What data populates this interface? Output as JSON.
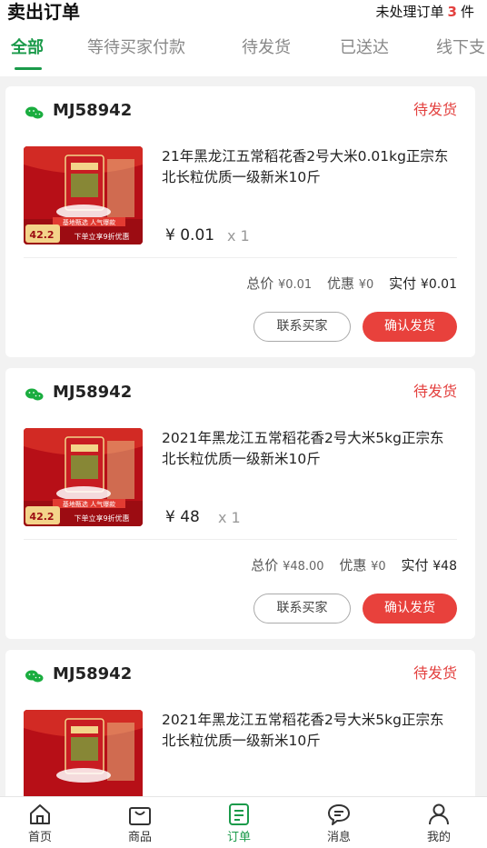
{
  "header": {
    "title": "卖出订单",
    "pending_prefix": "未处理订单",
    "pending_count": "3",
    "pending_suffix": "件"
  },
  "tabs": [
    {
      "label": "全部"
    },
    {
      "label": "等待买家付款"
    },
    {
      "label": "待发货"
    },
    {
      "label": "已送达"
    },
    {
      "label": "线下支"
    }
  ],
  "orders": [
    {
      "order_id": "MJ58942",
      "status": "待发货",
      "product_name": "21年黑龙江五常稻花香2号大米0.01kg正宗东北长粒优质一级新米10斤",
      "price": "¥ 0.01",
      "qty": "x 1",
      "total_label": "总价",
      "total_value": "¥0.01",
      "discount_label": "优惠",
      "discount_value": "¥0",
      "paid_label": "实付",
      "paid_value": "¥0.01",
      "contact_btn": "联系买家",
      "confirm_btn": "确认发货"
    },
    {
      "order_id": "MJ58942",
      "status": "待发货",
      "product_name": "2021年黑龙江五常稻花香2号大米5kg正宗东北长粒优质一级新米10斤",
      "price": "¥ 48",
      "qty": "x 1",
      "total_label": "总价",
      "total_value": "¥48.00",
      "discount_label": "优惠",
      "discount_value": "¥0",
      "paid_label": "实付",
      "paid_value": "¥48",
      "contact_btn": "联系买家",
      "confirm_btn": "确认发货"
    },
    {
      "order_id": "MJ58942",
      "status": "待发货",
      "product_name": "2021年黑龙江五常稻花香2号大米5kg正宗东北长粒优质一级新米10斤"
    }
  ],
  "thumb": {
    "price_tag": "42.2",
    "promo": "下单立享9折优惠",
    "banner": "基地甄选 人气爆款"
  },
  "nav": [
    {
      "label": "首页",
      "icon": "home-icon"
    },
    {
      "label": "商品",
      "icon": "bag-icon"
    },
    {
      "label": "订单",
      "icon": "order-icon"
    },
    {
      "label": "消息",
      "icon": "message-icon"
    },
    {
      "label": "我的",
      "icon": "profile-icon"
    }
  ],
  "colors": {
    "accent_green": "#1a9a4a",
    "status_red": "#e3413f",
    "button_red": "#e8413c"
  }
}
